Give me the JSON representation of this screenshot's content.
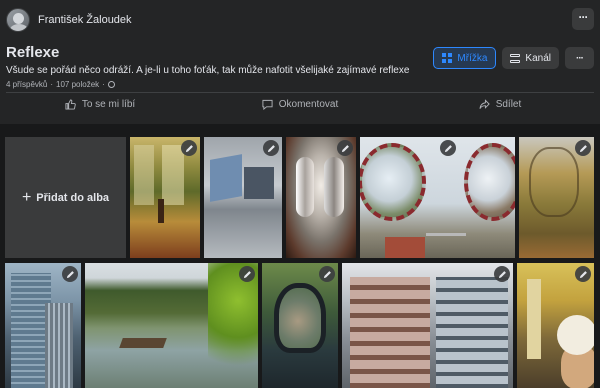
{
  "owner": {
    "name": "František Žaloudek"
  },
  "album": {
    "title": "Reflexe",
    "description": "Všude se pořád něco odráží. A je-li u toho foťák, tak může nafotit všelijaké zajímavé reflexe",
    "posts": "4 příspěvků",
    "items": "107 položek",
    "privacy_icon": "globe-icon"
  },
  "view": {
    "grid_label": "Mřížka",
    "feed_label": "Kanál",
    "more": "···"
  },
  "top_more": "···",
  "actions": {
    "like": "To se mi líbí",
    "comment": "Okomentovat",
    "share": "Sdílet"
  },
  "add_to_album": {
    "plus": "+",
    "label": "Přidat do alba"
  },
  "colors": {
    "background": "#18191a",
    "card": "#242526",
    "accent": "#2d88ff",
    "button": "#3a3b3c"
  }
}
